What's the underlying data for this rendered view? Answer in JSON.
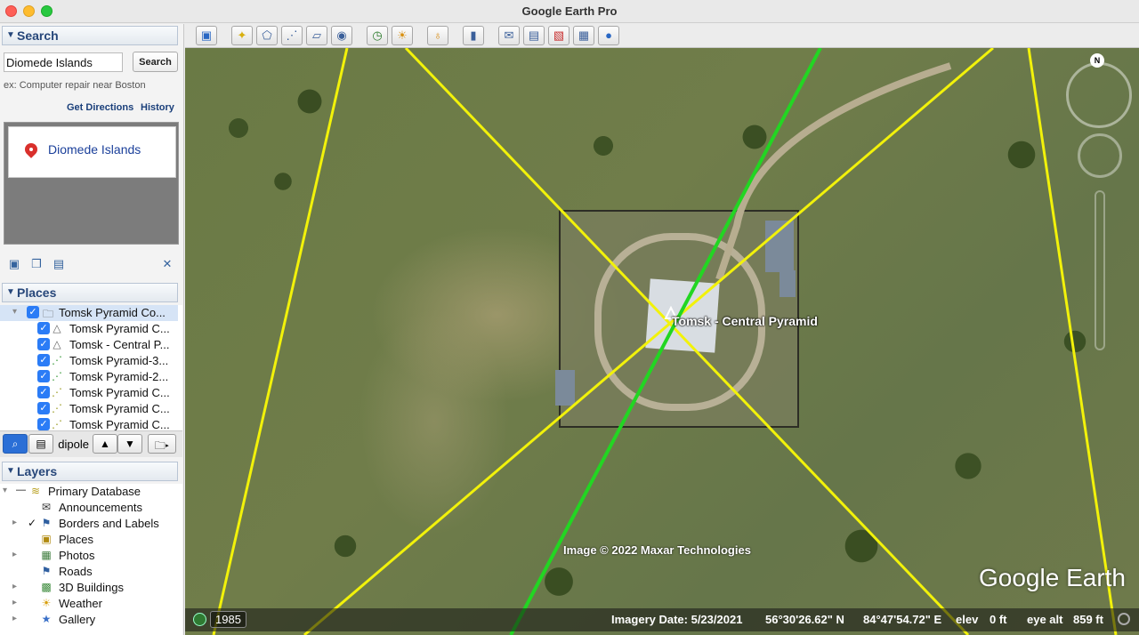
{
  "window": {
    "title": "Google Earth Pro"
  },
  "search": {
    "header": "Search",
    "query": "Diomede Islands",
    "button": "Search",
    "hint": "ex: Computer repair near Boston",
    "get_directions": "Get Directions",
    "history": "History",
    "result": "Diomede Islands"
  },
  "places": {
    "header": "Places",
    "items": [
      {
        "label": "Tomsk Pyramid Co...",
        "checked": true,
        "icon": "folder-icon"
      },
      {
        "label": "Tomsk Pyramid C...",
        "checked": true,
        "icon": "placemark-icon"
      },
      {
        "label": "Tomsk - Central P...",
        "checked": true,
        "icon": "placemark-icon"
      },
      {
        "label": "Tomsk Pyramid-3...",
        "checked": true,
        "icon": "path-icon"
      },
      {
        "label": "Tomsk Pyramid-2...",
        "checked": true,
        "icon": "path-icon"
      },
      {
        "label": "Tomsk Pyramid C...",
        "checked": true,
        "icon": "path-icon"
      },
      {
        "label": "Tomsk Pyramid C...",
        "checked": true,
        "icon": "path-icon"
      },
      {
        "label": "Tomsk Pyramid C...",
        "checked": true,
        "icon": "path-icon"
      }
    ],
    "partial_label": "dipole"
  },
  "layers": {
    "header": "Layers",
    "items": [
      {
        "label": "Primary Database"
      },
      {
        "label": "Announcements"
      },
      {
        "label": "Borders and Labels"
      },
      {
        "label": "Places"
      },
      {
        "label": "Photos"
      },
      {
        "label": "Roads"
      },
      {
        "label": "3D Buildings"
      },
      {
        "label": "Weather"
      },
      {
        "label": "Gallery"
      }
    ]
  },
  "map": {
    "placemark_label": "Tomsk - Central Pyramid",
    "image_credit": "Image © 2022 Maxar Technologies",
    "logo": "Google Earth",
    "compass_letter": "N"
  },
  "status": {
    "year": "1985",
    "imagery_date": "Imagery Date: 5/23/2021",
    "lat": "56°30'26.62\" N",
    "lon": "84°47'54.72\" E",
    "elev_label": "elev",
    "elev_value": "0 ft",
    "eye_label": "eye alt",
    "eye_value": "859 ft"
  },
  "colors": {
    "guide_line_yellow": "#f2f20a",
    "guide_line_green": "#22d622",
    "accent": "#2b7cf6"
  }
}
